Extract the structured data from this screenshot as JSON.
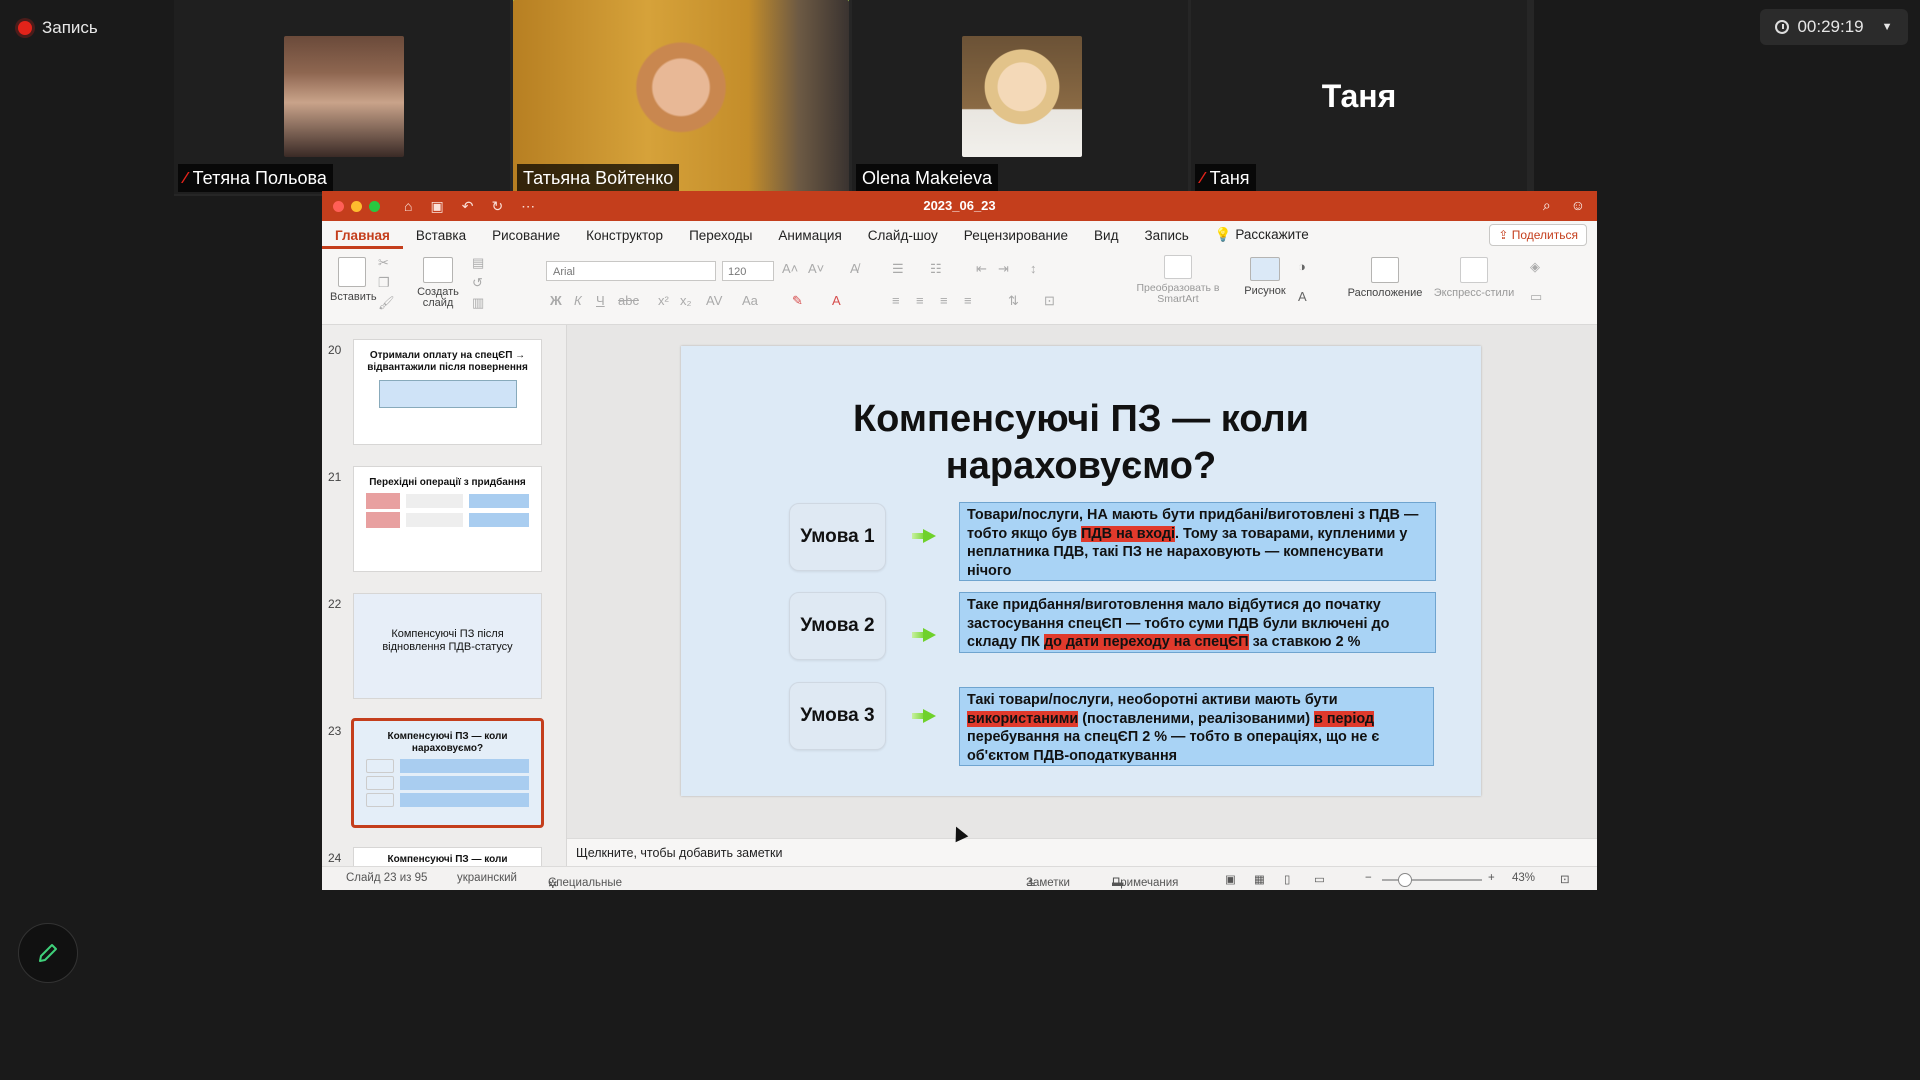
{
  "recording": {
    "label": "Запись"
  },
  "timer": {
    "value": "00:29:19"
  },
  "participants": [
    {
      "name": "Тетяна Польова",
      "muted": true
    },
    {
      "name": "Татьяна Войтенко",
      "muted": false
    },
    {
      "name": "Olena Makeieva",
      "muted": false
    },
    {
      "name": "Таня",
      "muted": true,
      "display_text": "Таня"
    }
  ],
  "ppt": {
    "doc_title": "2023_06_23",
    "menu": [
      "Главная",
      "Вставка",
      "Рисование",
      "Конструктор",
      "Переходы",
      "Анимация",
      "Слайд-шоу",
      "Рецензирование",
      "Вид",
      "Запись",
      "Расскажите"
    ],
    "share_label": "Поделиться",
    "ribbon": {
      "paste": "Вставить",
      "new_slide": "Создать слайд",
      "font": "Arial",
      "size": "120",
      "smartart": "Преобразовать в SmartArt",
      "picture": "Рисунок",
      "arrange": "Расположение",
      "styles": "Экспресс-стили"
    },
    "thumbnails": [
      {
        "num": "20",
        "title": "Отримали оплату на спецЄП → відвантажили після повернення"
      },
      {
        "num": "21",
        "title": "Перехідні операції з придбання"
      },
      {
        "num": "22",
        "title": "Компенсуючі ПЗ після відновлення ПДВ-статусу"
      },
      {
        "num": "23",
        "title": "Компенсуючі ПЗ — коли нараховуємо?"
      },
      {
        "num": "24",
        "title": "Компенсуючі ПЗ — коли нараховуємо?"
      }
    ],
    "slide": {
      "title_line1": "Компенсуючі ПЗ — коли",
      "title_line2": "нараховуємо?",
      "conditions": [
        {
          "label": "Умова 1",
          "text_a": "Товари/послуги, НА мають бути придбані/виготовлені з ПДВ — тобто якщо був ",
          "hl_a": "ПДВ на вході",
          "text_b": ". Тому за товарами, купленими у неплатника ПДВ, такі ПЗ не нараховують — компенсувати нічого"
        },
        {
          "label": "Умова 2",
          "text_a": "Таке придбання/виготовлення мало відбутися до початку застосування спецЄП — тобто суми ПДВ були включені до складу ПК ",
          "hl_a": "до дати переходу на спецЄП",
          "text_b": " за ставкою 2 %"
        },
        {
          "label": "Умова 3",
          "text_a": "Такі товари/послуги, необоротні активи мають бути ",
          "hl_a": "використаними",
          "text_b": " (поставленими, реалізованими) ",
          "hl_b": "в період",
          "text_c": " перебування на спецЄП 2 % — тобто в операціях, що не є об'єктом ПДВ-оподаткування"
        }
      ]
    },
    "notes_placeholder": "Щелкните, чтобы добавить заметки",
    "status": {
      "slide_pos": "Слайд 23 из 95",
      "language": "украинский",
      "accessibility": "Специальные возможности: проверьте рекомендации",
      "notes": "Заметки",
      "comments": "Примечания",
      "zoom": "43%"
    }
  },
  "colors": {
    "ppt_accent": "#c43e1c",
    "active_speaker": "#a6d84c",
    "record": "#e2231a"
  }
}
